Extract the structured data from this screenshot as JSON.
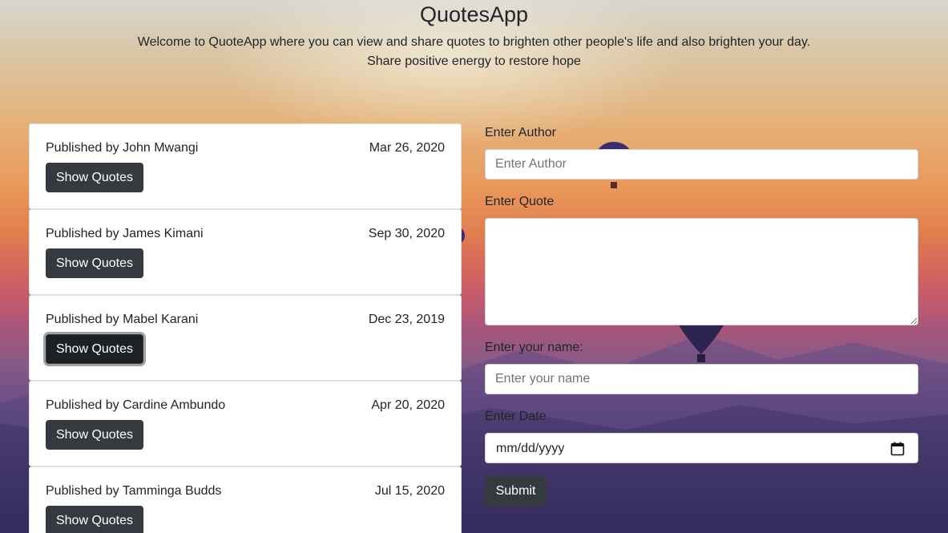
{
  "header": {
    "title": "QuotesApp",
    "welcome": "Welcome to QuoteApp where you can view and share quotes to brighten other people's life and also brighten your day.",
    "tagline": "Share positive energy to restore hope"
  },
  "quotes": [
    {
      "author_text": "Published by John Mwangi",
      "date": "Mar 26, 2020",
      "button_label": "Show Quotes"
    },
    {
      "author_text": "Published by James Kimani",
      "date": "Sep 30, 2020",
      "button_label": "Show Quotes"
    },
    {
      "author_text": "Published by Mabel Karani",
      "date": "Dec 23, 2019",
      "button_label": "Show Quotes"
    },
    {
      "author_text": "Published by Cardine Ambundo",
      "date": "Apr 20, 2020",
      "button_label": "Show Quotes"
    },
    {
      "author_text": "Published by Tamminga Budds",
      "date": "Jul 15, 2020",
      "button_label": "Show Quotes"
    }
  ],
  "form": {
    "author_label": "Enter Author",
    "author_placeholder": "Enter Author",
    "author_value": "",
    "quote_label": "Enter Quote",
    "quote_value": "",
    "name_label": "Enter your name:",
    "name_placeholder": "Enter your name",
    "name_value": "",
    "date_label": "Enter Date",
    "date_placeholder": "mm/dd/yyyy",
    "date_icon": "calendar-icon",
    "submit_label": "Submit"
  },
  "colors": {
    "button_dark": "#343a40",
    "card_bg": "#ffffff"
  }
}
